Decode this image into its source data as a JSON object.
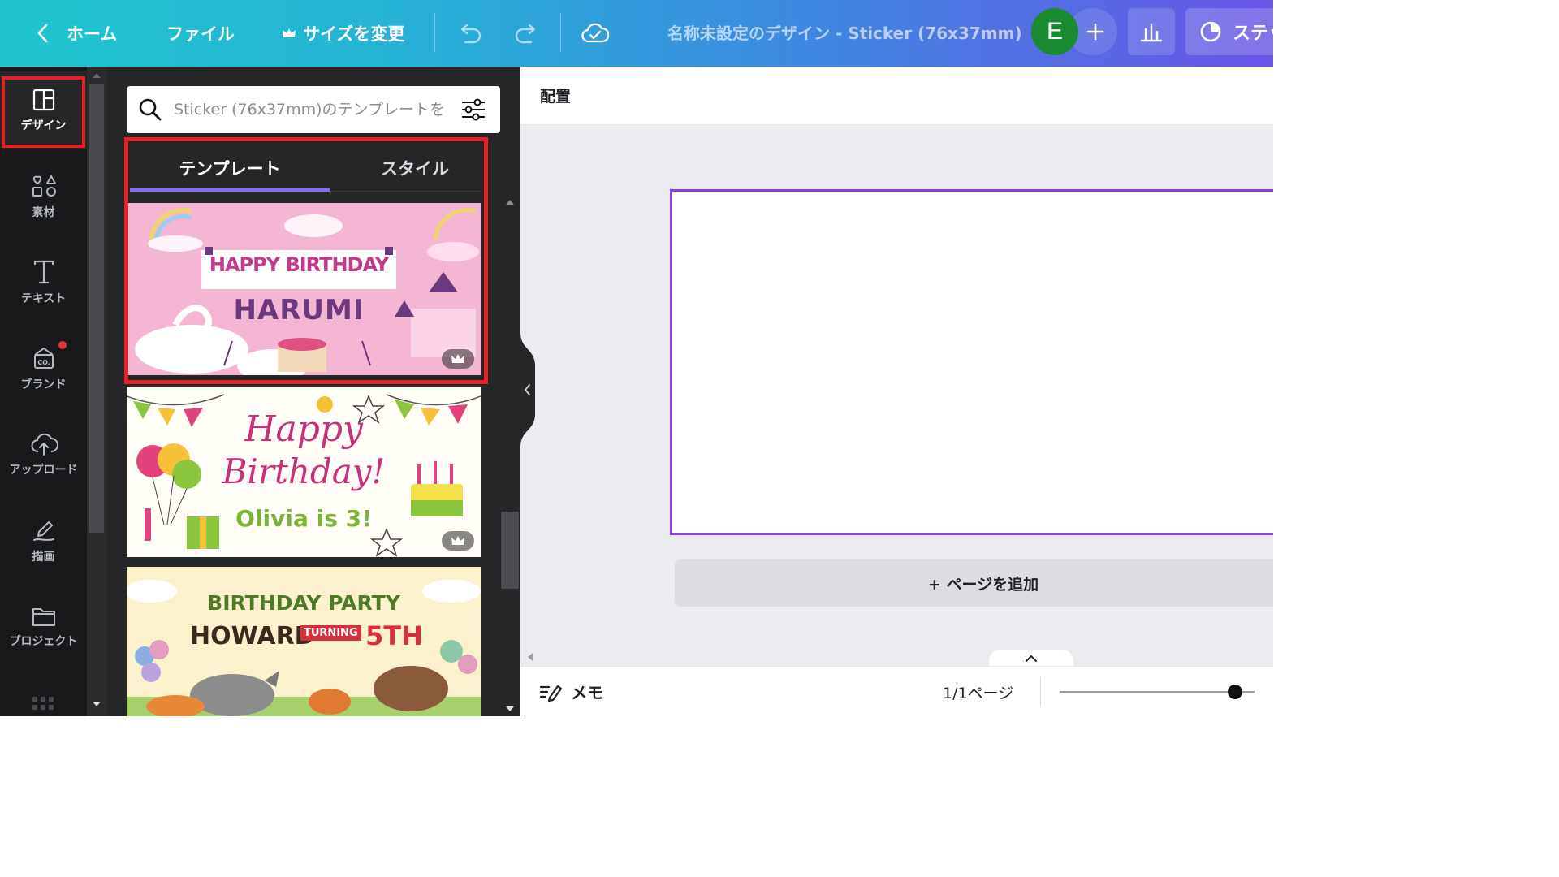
{
  "topbar": {
    "home_label": "ホーム",
    "file_label": "ファイル",
    "resize_label": "サイズを変更",
    "doc_title": "名称未設定のデザイン - Sticker (76x37mm)",
    "avatar_initial": "E",
    "share_label": "ステッ"
  },
  "sidebar": {
    "items": [
      {
        "label": "デザイン",
        "icon": "layout-icon"
      },
      {
        "label": "素材",
        "icon": "shapes-icon"
      },
      {
        "label": "テキスト",
        "icon": "text-icon"
      },
      {
        "label": "ブランド",
        "icon": "brand-icon"
      },
      {
        "label": "アップロード",
        "icon": "upload-icon"
      },
      {
        "label": "描画",
        "icon": "draw-icon"
      },
      {
        "label": "プロジェクト",
        "icon": "folder-icon"
      }
    ]
  },
  "panel": {
    "search_placeholder": "Sticker (76x37mm)のテンプレートを",
    "tabs": [
      {
        "label": "テンプレート",
        "active": true
      },
      {
        "label": "スタイル",
        "active": false
      }
    ],
    "templates": [
      {
        "lines": [
          "HAPPY BIRTHDAY",
          "HARUMI"
        ],
        "premium": true
      },
      {
        "lines": [
          "Happy",
          "Birthday!",
          "Olivia is 3!"
        ],
        "premium": true
      },
      {
        "lines": [
          "BIRTHDAY PARTY",
          "HOWARD",
          "TURNING",
          "5TH"
        ],
        "premium": false
      }
    ]
  },
  "main": {
    "position_label": "配置",
    "add_page_label": "+ ページを追加"
  },
  "bottombar": {
    "memo_label": "メモ",
    "page_indicator": "1/1ページ",
    "zoom_level": 0.9
  },
  "colors": {
    "accent": "#8b3df0",
    "highlight": "#e8202a",
    "avatar": "#1a8a2e",
    "rail_bg": "#18191b",
    "panel_bg": "#252627"
  }
}
